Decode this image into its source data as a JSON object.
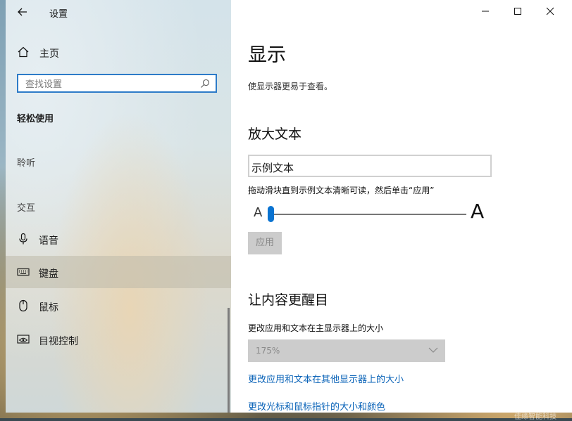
{
  "window": {
    "title": "设置",
    "controls": {
      "minimize": "minimize",
      "maximize": "maximize",
      "close": "close"
    }
  },
  "sidebar": {
    "home_label": "主页",
    "search_placeholder": "查找设置",
    "section_title": "轻松使用",
    "groups": {
      "hearing": "聆听",
      "interaction": "交互"
    },
    "items": [
      {
        "label": "语音",
        "icon": "microphone-icon",
        "selected": false
      },
      {
        "label": "键盘",
        "icon": "keyboard-icon",
        "selected": true
      },
      {
        "label": "鼠标",
        "icon": "mouse-icon",
        "selected": false
      },
      {
        "label": "目视控制",
        "icon": "eye-control-icon",
        "selected": false
      }
    ]
  },
  "main": {
    "title": "显示",
    "description": "使显示器更易于查看。",
    "text_section": {
      "heading": "放大文本",
      "sample_text": "示例文本",
      "instruction": "拖动滑块直到示例文本清晰可读，然后单击“应用”",
      "slider_min_label": "A",
      "slider_max_label": "A",
      "slider_value": 0,
      "apply_label": "应用"
    },
    "content_section": {
      "heading": "让内容更醒目",
      "scale_label": "更改应用和文本在主显示器上的大小",
      "scale_value": "175%",
      "links": [
        "更改应用和文本在其他显示器上的大小",
        "更改光标和鼠标指针的大小和颜色"
      ]
    }
  },
  "colors": {
    "accent": "#0a73d1",
    "link": "#0a63b8",
    "search_border": "#2d7bc8"
  },
  "watermark": "佳缘智能科技"
}
